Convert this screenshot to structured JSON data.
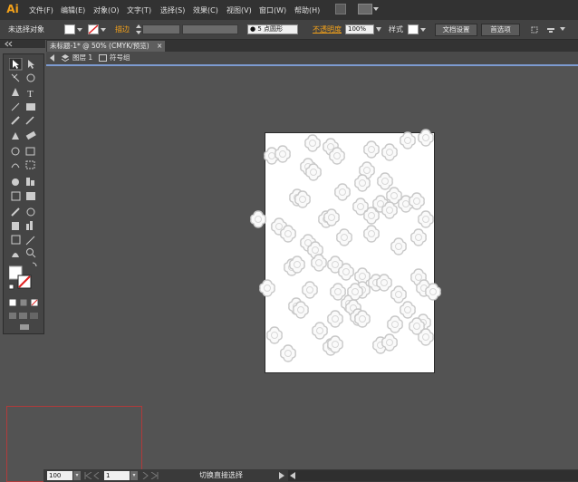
{
  "app": {
    "logo": "Ai"
  },
  "menu": [
    "文件(F)",
    "编辑(E)",
    "对象(O)",
    "文字(T)",
    "选择(S)",
    "效果(C)",
    "视图(V)",
    "窗口(W)",
    "帮助(H)"
  ],
  "control_bar": {
    "selection_status": "未选择对象",
    "stroke_label": "描边",
    "brush_value": "5 点圆形",
    "opacity_label": "不透明度",
    "opacity_value": "100%",
    "style_label": "样式",
    "doc_setup_button": "文档设置",
    "preferences_button": "首选项"
  },
  "document": {
    "tab_title": "未标题-1* @ 50% (CMYK/预览)",
    "close_glyph": "×",
    "breadcrumb_layer": "图层 1",
    "breadcrumb_group": "符号组"
  },
  "status_bar": {
    "zoom_value": "100",
    "page_value": "1",
    "status_text": "切换直接选择"
  },
  "colors": {
    "accent_orange": "#f4a21a",
    "selection_blue": "#7d9bd1",
    "marquee_red": "#b03b3b"
  }
}
